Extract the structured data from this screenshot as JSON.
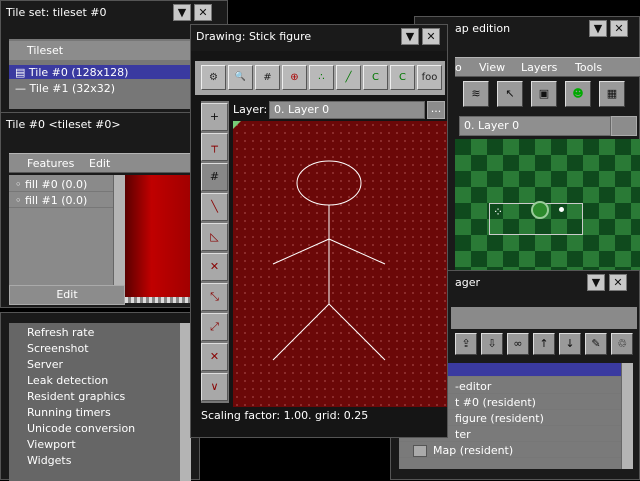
{
  "tileset_window": {
    "title": "Tile set: tileset #0",
    "column_header": "Tileset",
    "items": [
      "Tile #0 (128x128)",
      "Tile #1 (32x32)"
    ]
  },
  "tile_window": {
    "title": "Tile #0 <tileset #0>",
    "menu": [
      "Features",
      "Edit"
    ],
    "features": [
      "fill #0 (0.0)",
      "fill #1 (0.0)"
    ],
    "edit_button": "Edit"
  },
  "debug_list": {
    "items": [
      "Refresh rate",
      "Screenshot",
      "Server",
      "Leak detection",
      "Resident graphics",
      "Running timers",
      "Unicode conversion",
      "Viewport",
      "Widgets"
    ]
  },
  "map_window": {
    "title_visible": "ap edition",
    "menu": [
      "o",
      "View",
      "Layers",
      "Tools"
    ],
    "layer_field": "0. Layer 0"
  },
  "manager_window": {
    "title_visible": "ager",
    "items": [
      "-editor",
      "t #0 (resident)",
      "figure (resident)",
      "ter",
      "Map (resident)"
    ]
  },
  "drawing_window": {
    "title": "Drawing: Stick figure",
    "toolbar": [
      "⚙",
      "🔍",
      "#",
      "⊕",
      "∴",
      "╱",
      "C",
      "C",
      "foo"
    ],
    "layer_label": "Layer:",
    "layer_value": "0. Layer 0",
    "layer_more": "...",
    "left_tools": [
      "+",
      "┬",
      "#",
      "╲",
      "◺",
      "✕",
      "⤡",
      "⤢",
      "✕",
      "∨"
    ],
    "status": "Scaling factor: 1.00. grid: 0.25"
  },
  "window_buttons": {
    "minimize": "▼",
    "close": "✕"
  },
  "colors": {
    "canvas_bg": "#6b0808",
    "map_dark": "#0f4a1d",
    "map_light": "#2a7a36",
    "selection": "#3a3aa0"
  },
  "icons": {
    "minimize": "chevron-down-icon",
    "close": "close-icon"
  }
}
